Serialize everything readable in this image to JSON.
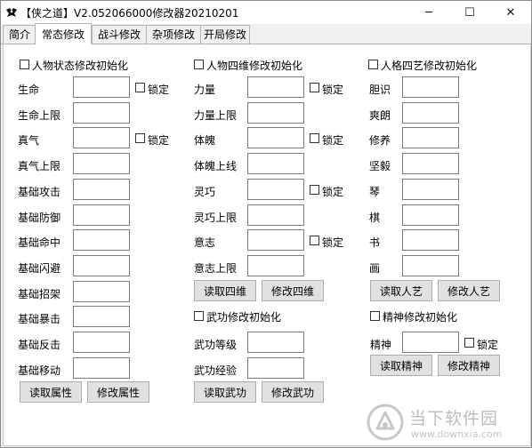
{
  "window": {
    "title": "【侠之道】V2.052066000修改器20210201",
    "min_glyph": "─",
    "max_glyph": "☐",
    "close_glyph": "✕"
  },
  "tabs": [
    {
      "label": "简介",
      "active": false
    },
    {
      "label": "常态修改",
      "active": true
    },
    {
      "label": "战斗修改",
      "active": false
    },
    {
      "label": "杂项修改",
      "active": false
    },
    {
      "label": "开局修改",
      "active": false
    }
  ],
  "col1": {
    "init_label": "人物状态修改初始化",
    "fields": [
      {
        "label": "生命",
        "value": "",
        "lock": true
      },
      {
        "label": "生命上限",
        "value": "",
        "lock": false
      },
      {
        "label": "真气",
        "value": "",
        "lock": true
      },
      {
        "label": "真气上限",
        "value": "",
        "lock": false
      },
      {
        "label": "基础攻击",
        "value": "",
        "lock": false
      },
      {
        "label": "基础防御",
        "value": "",
        "lock": false
      },
      {
        "label": "基础命中",
        "value": "",
        "lock": false
      },
      {
        "label": "基础闪避",
        "value": "",
        "lock": false
      },
      {
        "label": "基础招架",
        "value": "",
        "lock": false
      },
      {
        "label": "基础暴击",
        "value": "",
        "lock": false
      },
      {
        "label": "基础反击",
        "value": "",
        "lock": false
      },
      {
        "label": "基础移动",
        "value": "",
        "lock": false
      }
    ],
    "read_button": "读取属性",
    "modify_button": "修改属性"
  },
  "col2": {
    "init_label": "人物四维修改初始化",
    "fields": [
      {
        "label": "力量",
        "value": "",
        "lock": true
      },
      {
        "label": "力量上限",
        "value": "",
        "lock": false
      },
      {
        "label": "体魄",
        "value": "",
        "lock": true
      },
      {
        "label": "体魄上线",
        "value": "",
        "lock": false
      },
      {
        "label": "灵巧",
        "value": "",
        "lock": true
      },
      {
        "label": "灵巧上限",
        "value": "",
        "lock": false
      },
      {
        "label": "意志",
        "value": "",
        "lock": true
      },
      {
        "label": "意志上限",
        "value": "",
        "lock": false
      }
    ],
    "read_button": "读取四维",
    "modify_button": "修改四维",
    "martial": {
      "init_label": "武功修改初始化",
      "fields": [
        {
          "label": "武功等级",
          "value": ""
        },
        {
          "label": "武功经验",
          "value": ""
        }
      ],
      "read_button": "读取武功",
      "modify_button": "修改武功"
    }
  },
  "col3": {
    "init_label": "人格四艺修改初始化",
    "fields": [
      {
        "label": "胆识",
        "value": ""
      },
      {
        "label": "爽朗",
        "value": ""
      },
      {
        "label": "修养",
        "value": ""
      },
      {
        "label": "坚毅",
        "value": ""
      },
      {
        "label": "琴",
        "value": ""
      },
      {
        "label": "棋",
        "value": ""
      },
      {
        "label": "书",
        "value": ""
      },
      {
        "label": "画",
        "value": ""
      }
    ],
    "read_button": "读取人艺",
    "modify_button": "修改人艺",
    "spirit": {
      "init_label": "精神修改初始化",
      "field": {
        "label": "精神",
        "value": ""
      },
      "lock": true,
      "read_button": "读取精神",
      "modify_button": "修改精神"
    }
  },
  "lock_label": "锁定",
  "watermark": {
    "name": "当下软件园",
    "url": "www.downxia.com",
    "color": "#bdbdbd"
  }
}
